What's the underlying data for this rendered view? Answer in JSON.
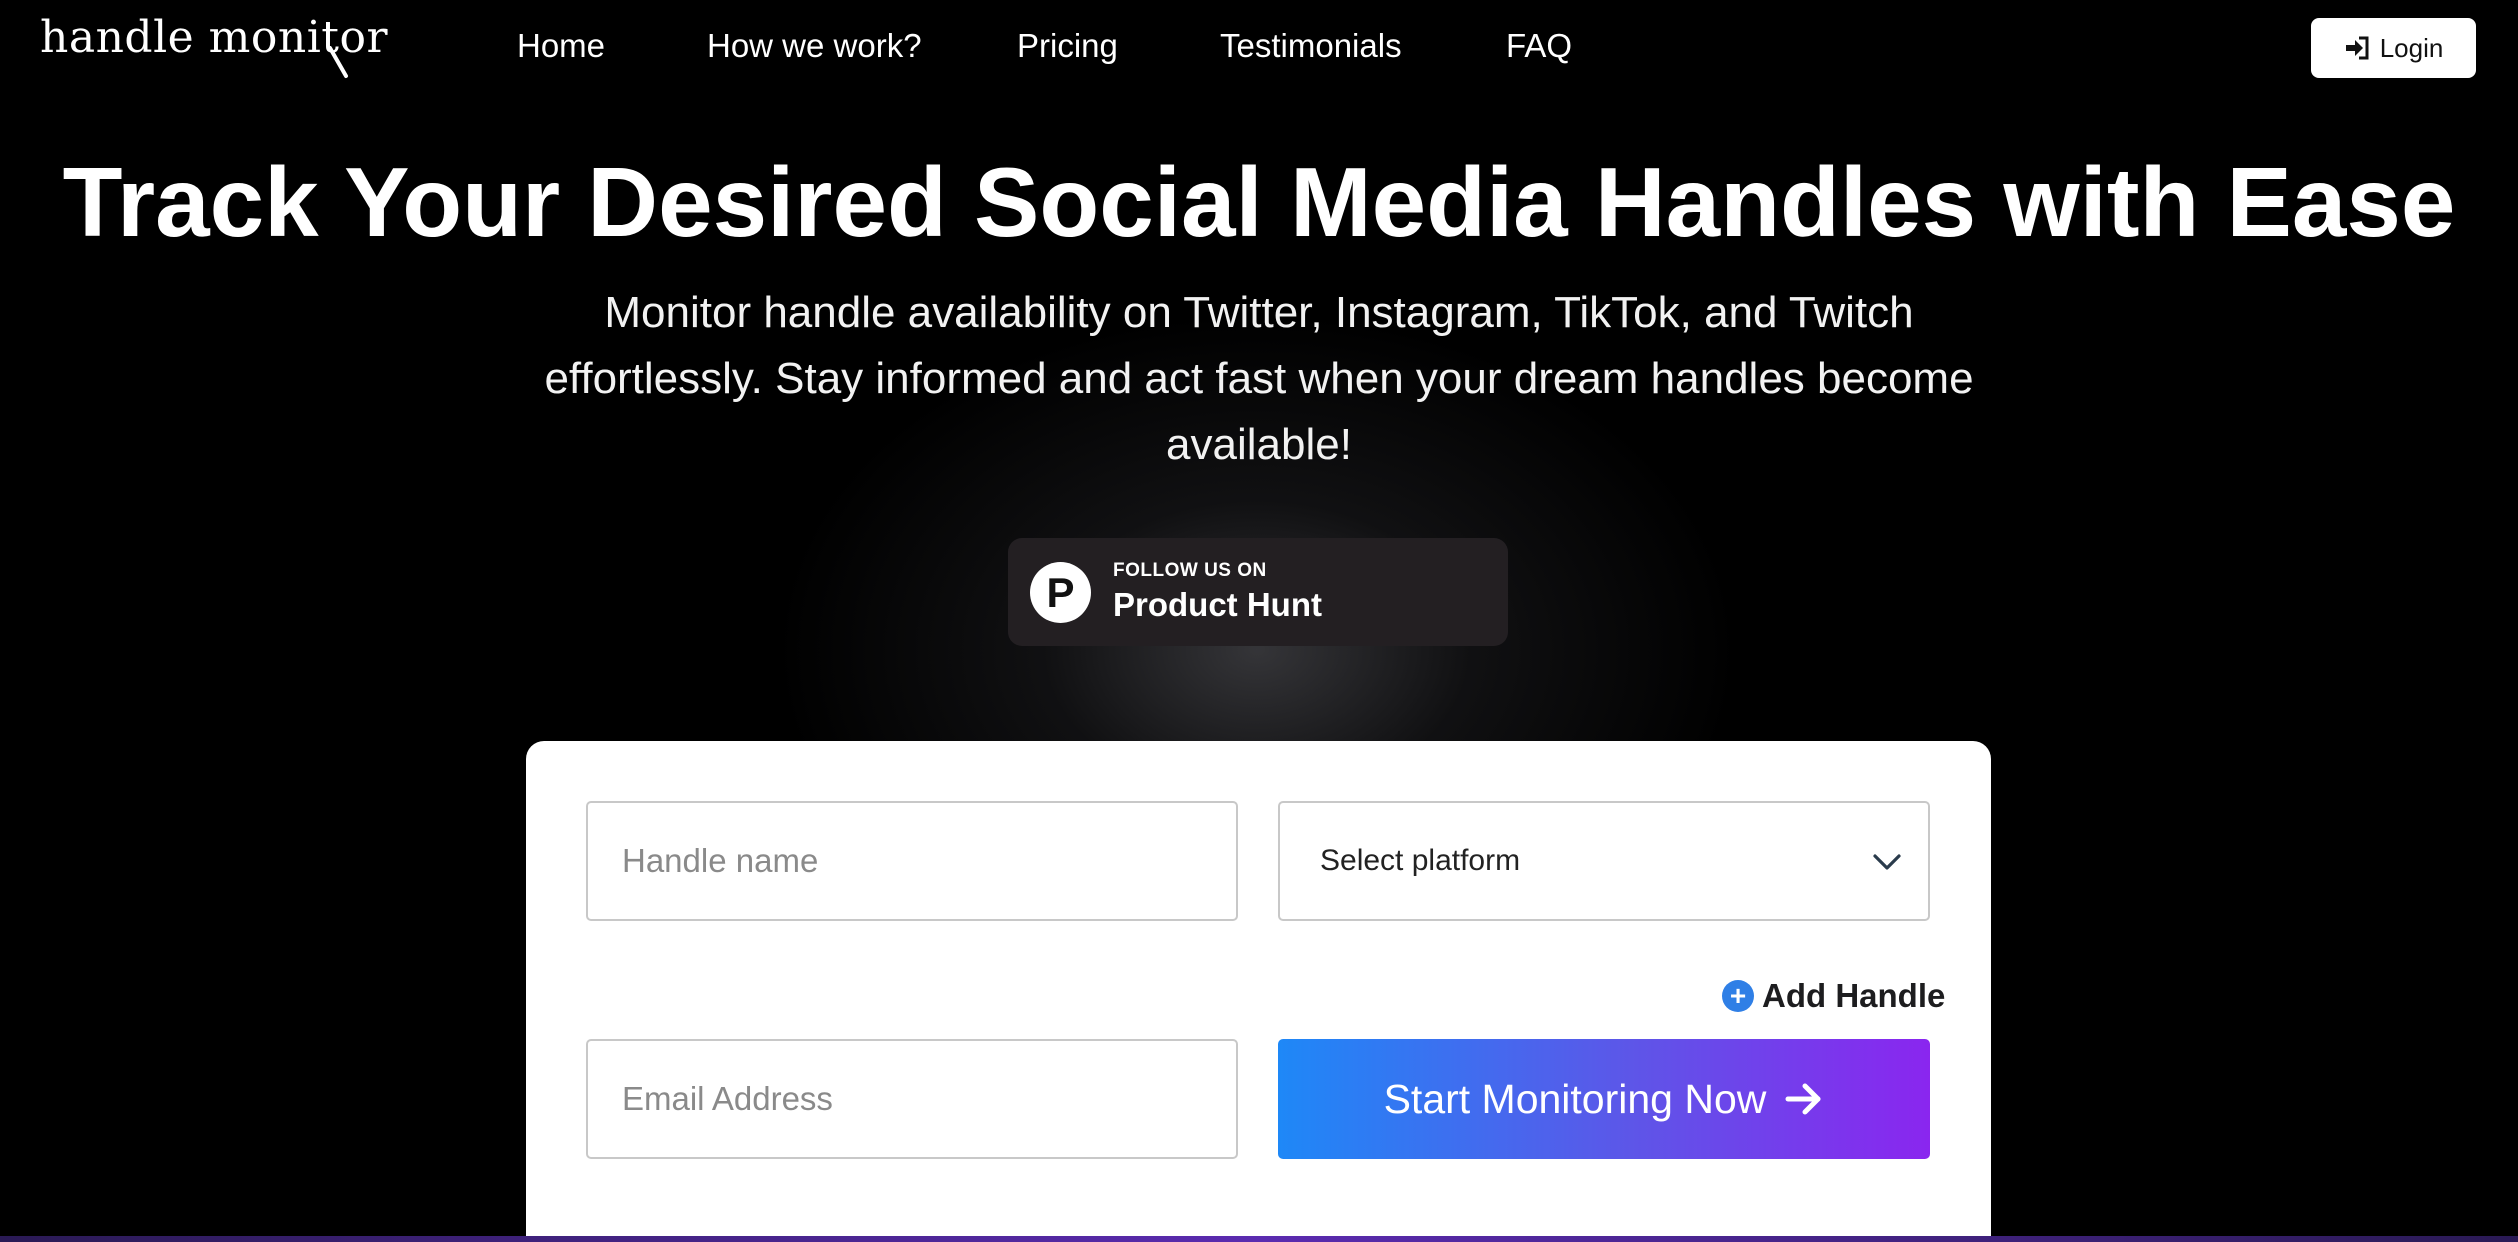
{
  "nav": {
    "logo_text": "handle monitor",
    "links": [
      "Home",
      "How we work?",
      "Pricing",
      "Testimonials",
      "FAQ"
    ],
    "login_label": "Login"
  },
  "hero": {
    "title": "Track Your Desired Social Media Handles with Ease",
    "subtitle": "Monitor handle availability on Twitter, Instagram, TikTok, and Twitch effortlessly. Stay informed and act fast when your dream handles become available!"
  },
  "product_hunt": {
    "logo_letter": "P",
    "small_text": "FOLLOW US ON",
    "big_text": "Product Hunt"
  },
  "form": {
    "handle_placeholder": "Handle name",
    "platform_selected": "Select platform",
    "add_handle_label": "Add Handle",
    "email_placeholder": "Email Address",
    "submit_label": "Start Monitoring Now"
  },
  "colors": {
    "background": "#000000",
    "button_gradient_start": "#1e88f7",
    "button_gradient_end": "#8a26ef",
    "add_icon": "#2f7fe6"
  },
  "icons": {
    "login": "sign-in-icon",
    "select": "chevron-down-icon",
    "add": "plus-circle-icon",
    "submit": "arrow-right-icon"
  }
}
